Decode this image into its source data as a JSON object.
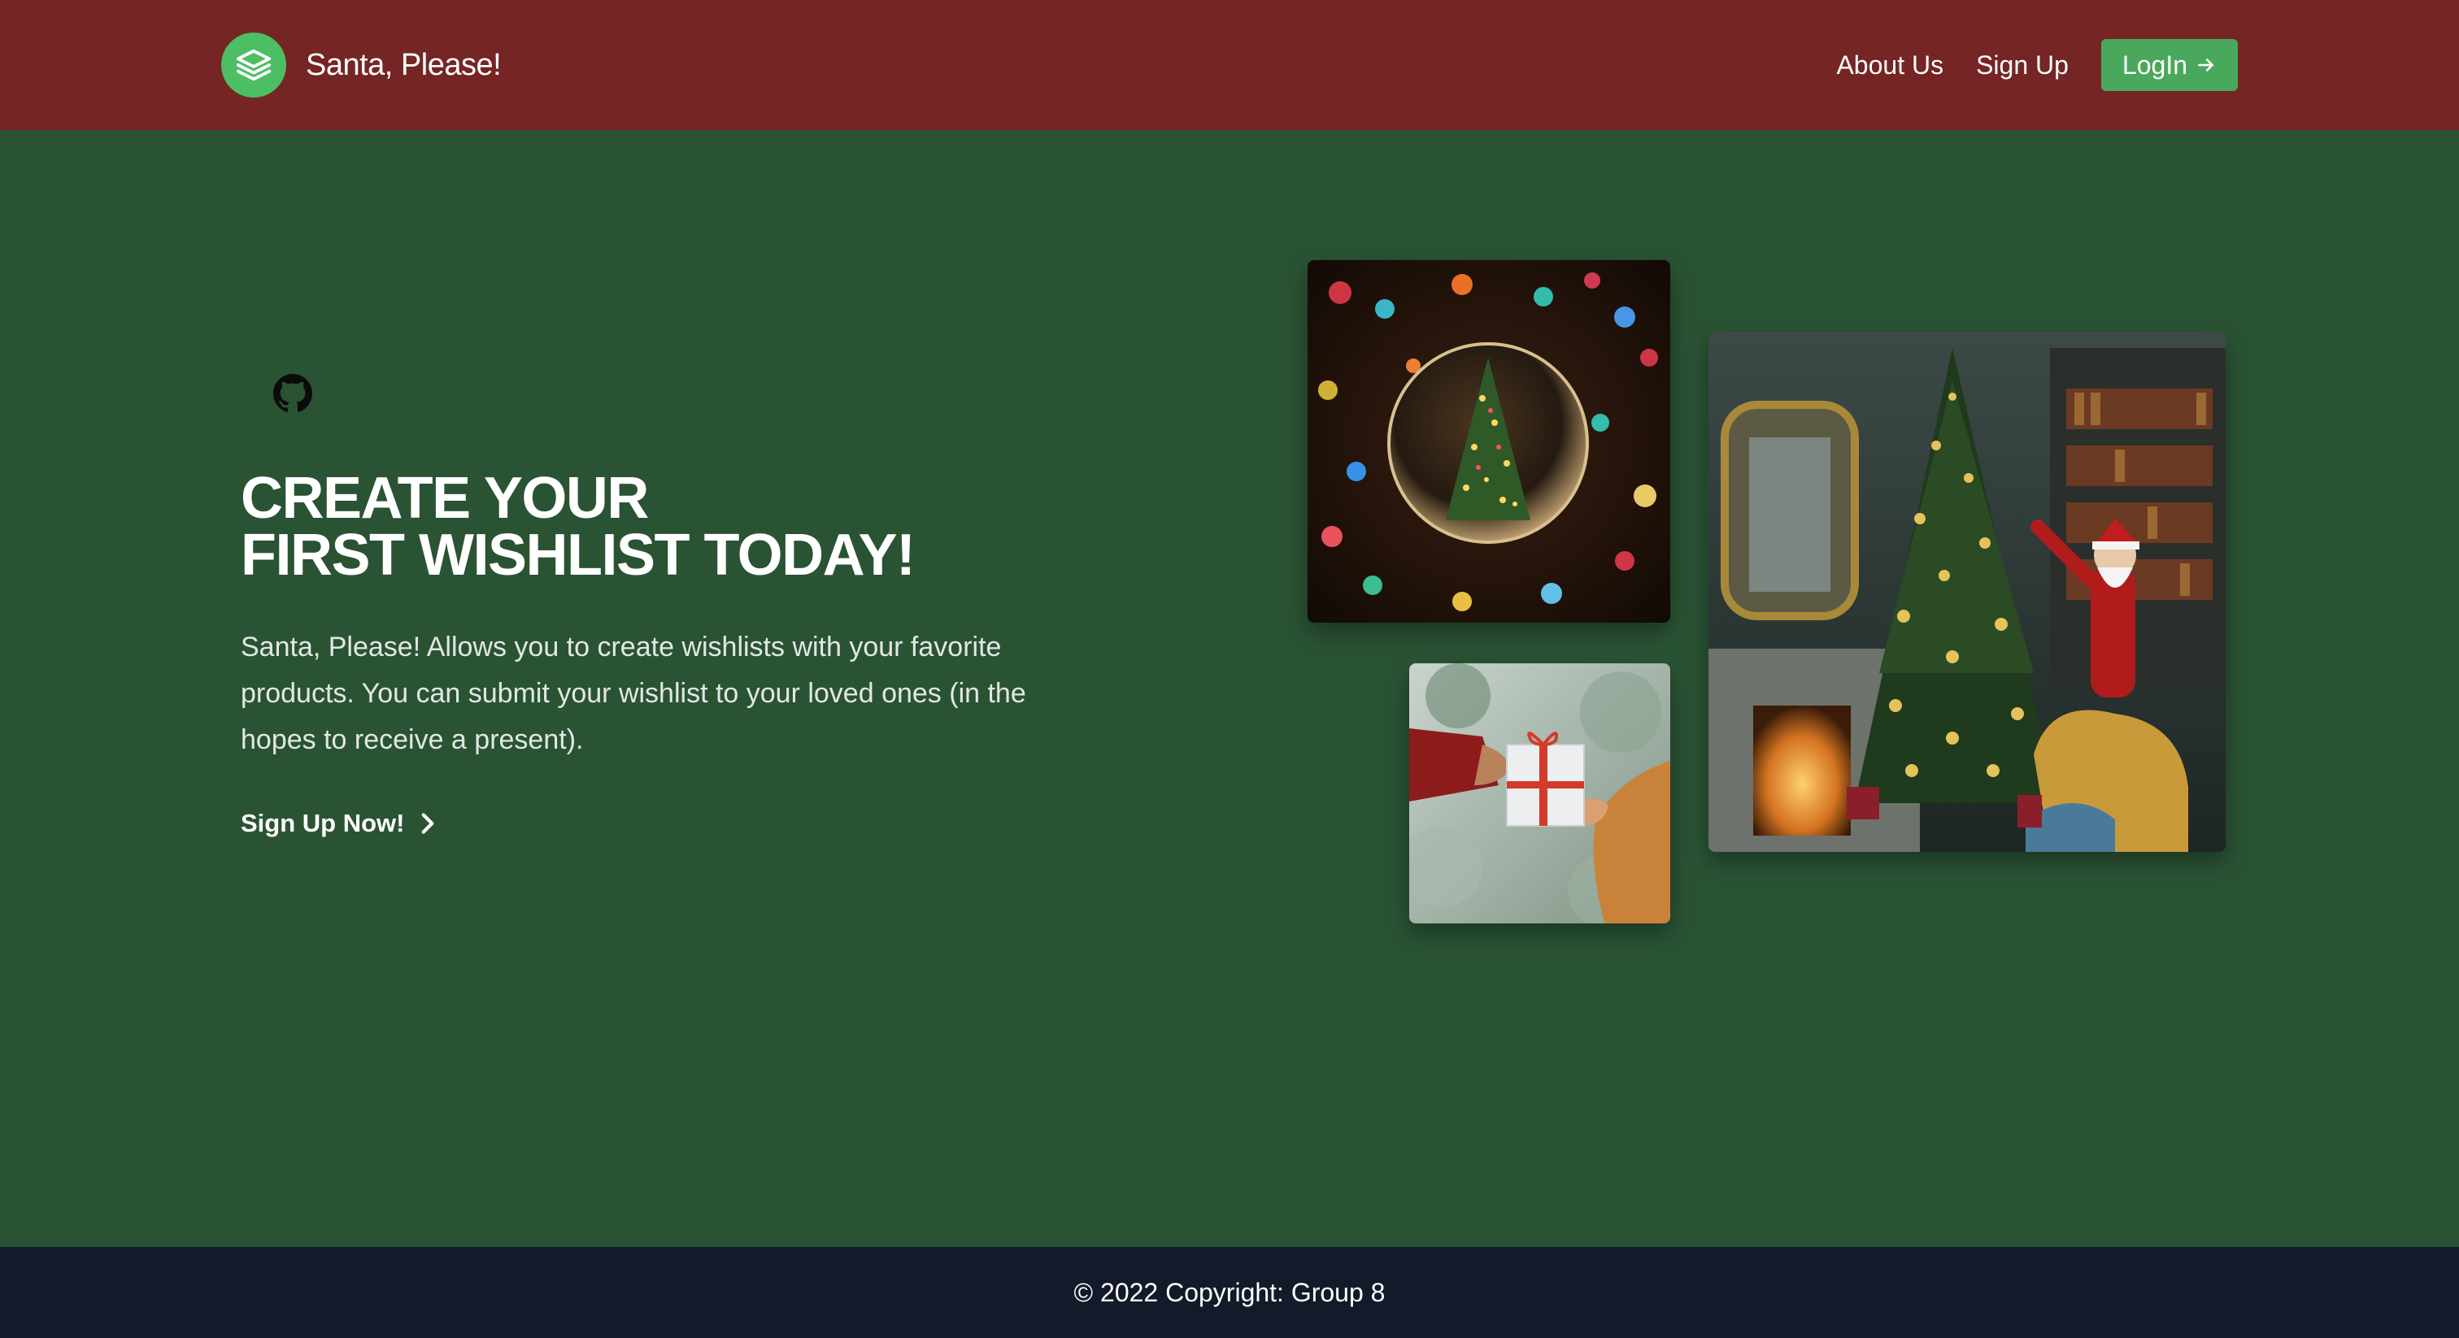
{
  "header": {
    "brand_name": "Santa, Please!",
    "logo_icon": "layers-icon",
    "nav": {
      "about_label": "About Us",
      "signup_label": "Sign Up",
      "login_label": "LogIn",
      "login_icon": "arrow-right-icon"
    }
  },
  "hero": {
    "github_icon": "github-icon",
    "title_line1": "CREATE YOUR",
    "title_line2": "FIRST WISHLIST TODAY!",
    "description": "Santa, Please! Allows you to create wishlists with your favorite products. You can submit your wishlist to your loved ones (in the hopes to receive a present).",
    "cta_label": "Sign Up Now!",
    "cta_icon": "chevron-right-icon"
  },
  "images": [
    {
      "name": "christmas-ornament-image"
    },
    {
      "name": "gift-exchange-image"
    },
    {
      "name": "santa-tree-image"
    }
  ],
  "footer": {
    "copyright": "© 2022 Copyright: Group 8"
  },
  "colors": {
    "header_bg": "#742524",
    "page_bg": "#2a5334",
    "accent_green": "#4aa85c",
    "footer_bg": "#131a2a"
  }
}
